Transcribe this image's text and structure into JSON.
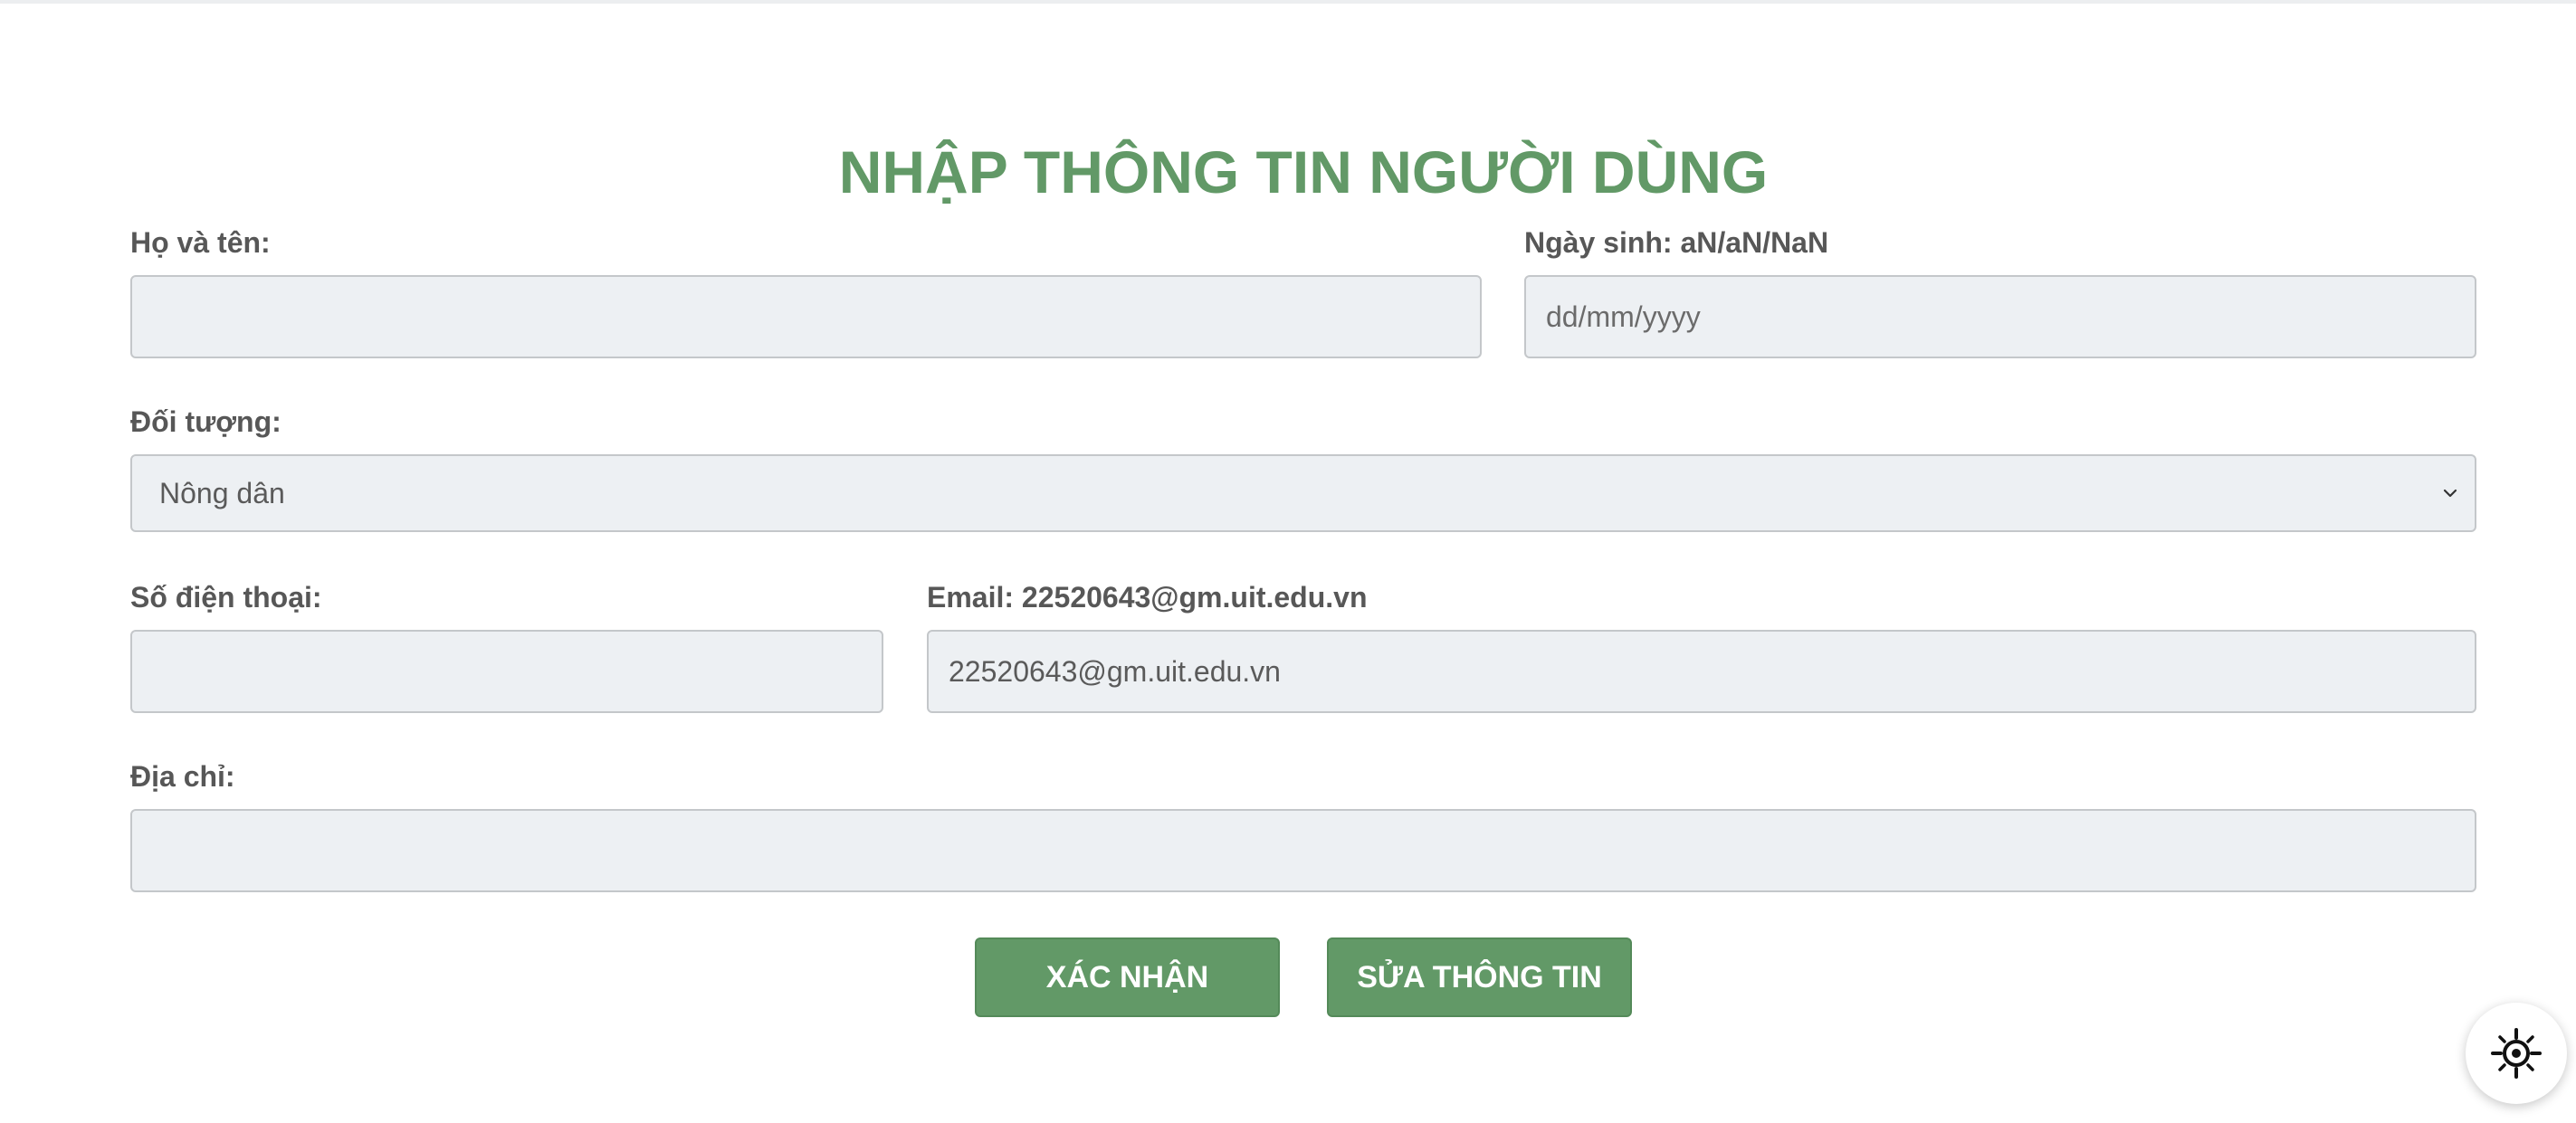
{
  "form": {
    "title": "NHẬP THÔNG TIN NGƯỜI DÙNG",
    "full_name": {
      "label": "Họ và tên:",
      "value": "",
      "placeholder": ""
    },
    "birth_date": {
      "label": "Ngày sinh: aN/aN/NaN",
      "value": "",
      "placeholder": "dd/mm/yyyy"
    },
    "category": {
      "label": "Đối tượng:",
      "selected": "Nông dân"
    },
    "phone": {
      "label": "Số điện thoại:",
      "value": "",
      "placeholder": ""
    },
    "email": {
      "label": "Email: 22520643@gm.uit.edu.vn",
      "value": "22520643@gm.uit.edu.vn",
      "placeholder": ""
    },
    "address": {
      "label": "Địa chỉ:",
      "value": "",
      "placeholder": ""
    },
    "buttons": {
      "confirm": "XÁC NHẬN",
      "edit": "SỬA THÔNG TIN"
    }
  },
  "widget": {
    "icon": "crosshair-gear-icon"
  },
  "colors": {
    "accent": "#629967",
    "field_bg": "#edf0f3",
    "field_border": "#c4c7ca",
    "label_text": "#575757"
  }
}
